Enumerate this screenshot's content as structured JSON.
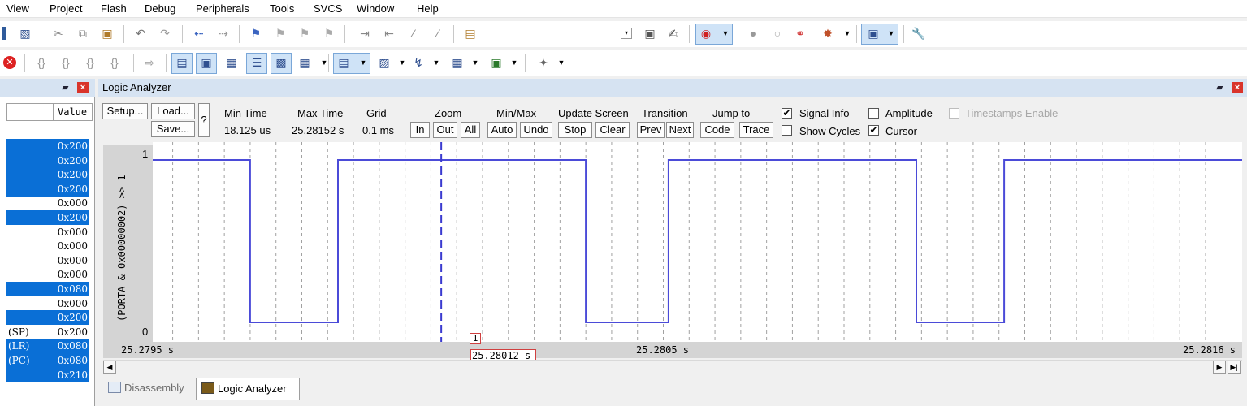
{
  "menu": [
    "View",
    "Project",
    "Flash",
    "Debug",
    "Peripherals",
    "Tools",
    "SVCS",
    "Window",
    "Help"
  ],
  "left_panel": {
    "column_header": "Value",
    "rows": [
      {
        "name": "",
        "value": "0x200",
        "selected": true
      },
      {
        "name": "",
        "value": "0x200",
        "selected": true
      },
      {
        "name": "",
        "value": "0x200",
        "selected": true
      },
      {
        "name": "",
        "value": "0x200",
        "selected": true
      },
      {
        "name": "",
        "value": "0x000",
        "selected": false
      },
      {
        "name": "",
        "value": "0x200",
        "selected": true
      },
      {
        "name": "",
        "value": "0x000",
        "selected": false
      },
      {
        "name": "",
        "value": "0x000",
        "selected": false
      },
      {
        "name": "",
        "value": "0x000",
        "selected": false
      },
      {
        "name": "",
        "value": "0x000",
        "selected": false
      },
      {
        "name": "",
        "value": "0x080",
        "selected": true
      },
      {
        "name": "",
        "value": "0x000",
        "selected": false
      },
      {
        "name": "",
        "value": "0x200",
        "selected": true
      },
      {
        "name": "(SP)",
        "value": "0x200",
        "selected": false
      },
      {
        "name": "(LR)",
        "value": "0x080",
        "selected": true
      },
      {
        "name": "(PC)",
        "value": "0x080",
        "selected": true
      },
      {
        "name": "",
        "value": "0x210",
        "selected": true
      }
    ]
  },
  "logic_analyzer": {
    "title": "Logic Analyzer",
    "setup_label": "Setup...",
    "load_label": "Load...",
    "save_label": "Save...",
    "help_label": "?",
    "min_time": {
      "label": "Min Time",
      "value": "18.125 us"
    },
    "max_time": {
      "label": "Max Time",
      "value": "25.28152 s"
    },
    "grid": {
      "label": "Grid",
      "value": "0.1 ms"
    },
    "zoom": {
      "label": "Zoom",
      "in": "In",
      "out": "Out",
      "all": "All"
    },
    "minmax": {
      "label": "Min/Max",
      "auto": "Auto",
      "undo": "Undo"
    },
    "update_screen": {
      "label": "Update Screen",
      "stop": "Stop",
      "clear": "Clear"
    },
    "transition": {
      "label": "Transition",
      "prev": "Prev",
      "next": "Next"
    },
    "jump_to": {
      "label": "Jump to",
      "code": "Code",
      "trace": "Trace"
    },
    "options": {
      "signal_info": {
        "label": "Signal Info",
        "checked": true
      },
      "show_cycles": {
        "label": "Show Cycles",
        "checked": false
      },
      "amplitude": {
        "label": "Amplitude",
        "checked": false
      },
      "cursor": {
        "label": "Cursor",
        "checked": true
      },
      "timestamps": {
        "label": "Timestamps Enable",
        "checked": false,
        "enabled": false
      }
    },
    "signal_name": "(PORTA & 0x00000002) >> 1",
    "y_max_label": "1",
    "y_min_label": "0",
    "time_labels": {
      "left": "25.2795 s",
      "middle": "25.2805 s",
      "right": "25.2816 s"
    },
    "cursor": {
      "marker": "1",
      "time": "25.28012 s"
    }
  },
  "chart_data": {
    "type": "line",
    "title": "",
    "xlabel": "",
    "ylabel": "(PORTA & 0x00000002) >> 1",
    "xlim": [
      25.2795,
      25.2816
    ],
    "ylim": [
      0,
      1
    ],
    "grid": true,
    "cursor_x": 25.28012,
    "series": [
      {
        "values_x": [
          25.27952,
          25.27952,
          25.27975,
          25.27975,
          25.27992,
          25.27992,
          25.2804,
          25.2804,
          25.28056,
          25.28056,
          25.28104,
          25.28104,
          25.28121,
          25.28121,
          25.28168,
          25.28168,
          25.28185,
          25.28185
        ],
        "values_y": [
          0,
          1,
          1,
          0,
          0,
          1,
          1,
          0,
          0,
          1,
          1,
          0,
          0,
          1,
          1,
          0,
          0,
          1
        ],
        "color": "#4b4bd8"
      }
    ]
  },
  "tabs": [
    {
      "label": "Disassembly",
      "active": false
    },
    {
      "label": "Logic Analyzer",
      "active": true
    }
  ],
  "colors": {
    "selection": "#0a6fd6",
    "signal": "#4b4bd8",
    "cursor": "#3a3ad0",
    "title_bar": "#d6e3f2"
  }
}
